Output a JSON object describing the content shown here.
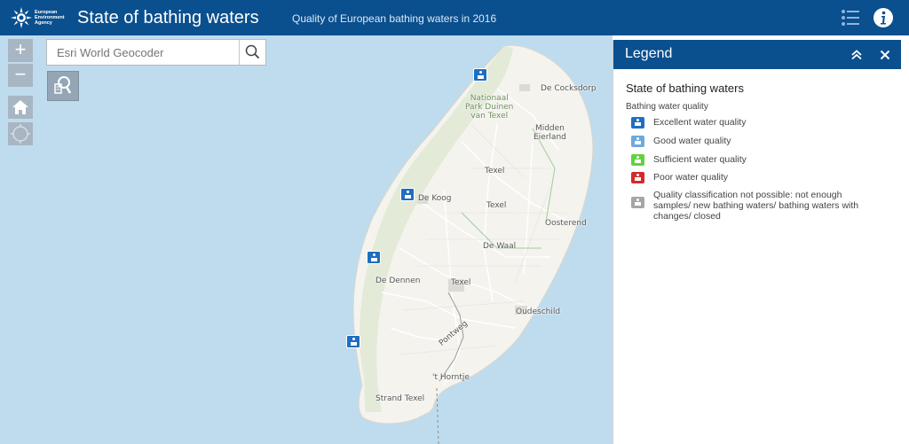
{
  "header": {
    "logo_lines": [
      "European",
      "Environment",
      "Agency"
    ],
    "title": "State of bathing waters",
    "subtitle": "Quality of European bathing waters in 2016",
    "icons": [
      "list-icon",
      "info-icon"
    ],
    "color": "#0a4f8e"
  },
  "map": {
    "controls": {
      "zoom_in": "+",
      "zoom_out": "−",
      "icons": [
        "home-icon",
        "locate-icon"
      ]
    },
    "search": {
      "placeholder": "Esri World Geocoder",
      "icon": "search-icon",
      "tool_icon": "search-tool-icon"
    },
    "places": {
      "cocksdorp": "De Cocksdorp",
      "nationaal_park": [
        "Nationaal",
        "Park Duinen",
        "van Texel"
      ],
      "midden_eierland": [
        "Midden",
        "Eierland"
      ],
      "texel_north": "Texel",
      "de_koog": "De Koog",
      "texel_mid": "Texel",
      "oosterend": "Oosterend",
      "de_waal": "De Waal",
      "de_dennen": "De Dennen",
      "texel_south": "Texel",
      "oudeschild": "Oudeschild",
      "pontweg": "Pontweg",
      "horntje": "'t Horntje",
      "strand_texel": "Strand Texel"
    },
    "colors": {
      "water": "#bfdcee",
      "land": "#f4f3ee",
      "dunes": "#e3ead8",
      "marker": "#1f6ec2"
    }
  },
  "legend": {
    "title": "Legend",
    "icons": [
      "collapse-icon",
      "close-icon"
    ],
    "layer_title": "State of bathing waters",
    "field_title": "Bathing water quality",
    "items": [
      {
        "label": "Excellent water quality",
        "color": "#1f6ec2"
      },
      {
        "label": "Good water quality",
        "color": "#6fa8dc"
      },
      {
        "label": "Sufficient water quality",
        "color": "#5fd33f"
      },
      {
        "label": "Poor water quality",
        "color": "#d32a2a"
      },
      {
        "label": "Quality classification not possible: not enough samples/ new bathing waters/ bathing waters with changes/ closed",
        "color": "#a6a6a6"
      }
    ]
  }
}
